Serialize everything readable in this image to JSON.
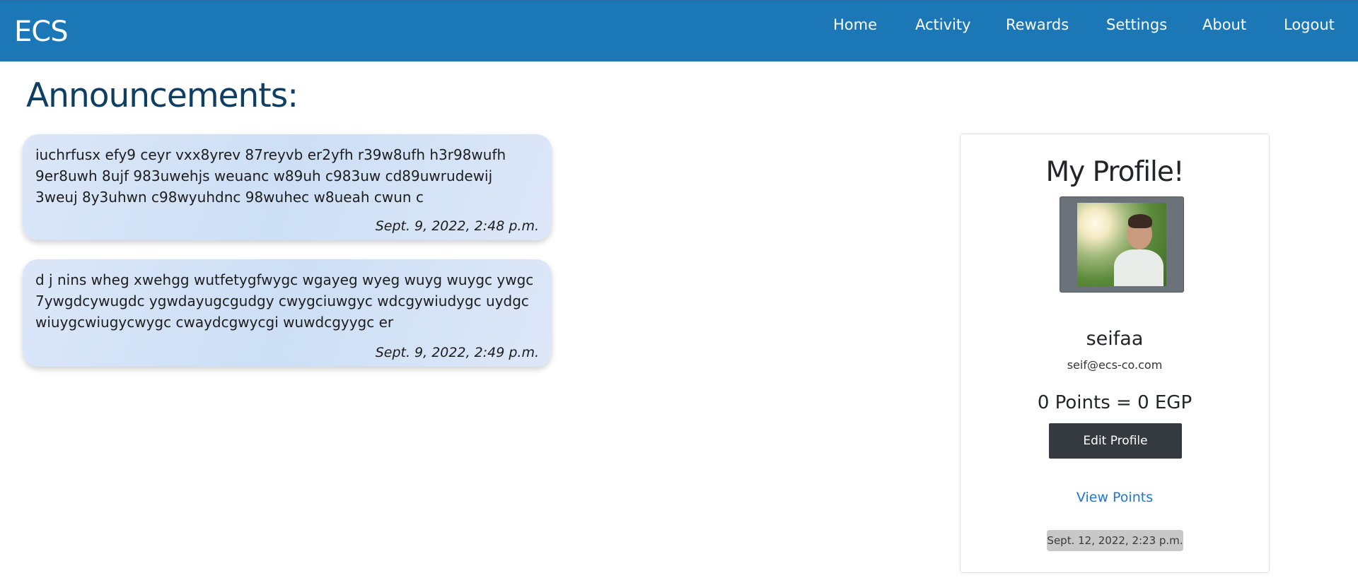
{
  "navbar": {
    "brand": "ECS",
    "links": [
      "Home",
      "Activity",
      "Rewards",
      "Settings",
      "About",
      "Logout"
    ]
  },
  "page": {
    "title": "Announcements:"
  },
  "announcements": [
    {
      "text": "iuchrfusx efy9 ceyr vxx8yrev 87reyvb er2yfh r39w8ufh h3r98wufh 9er8uwh 8ujf 983uwehjs weuanc w89uh c983uw cd89uwrudewij 3weuj 8y3uhwn c98wyuhdnc 98wuhec w8ueah cwun c",
      "time": "Sept. 9, 2022, 2:48 p.m."
    },
    {
      "text": "d j nins wheg xwehgg wutfetygfwygc wgayeg wyeg wuyg wuygc ywgc 7ywgdcywugdc ygwdayugcgudgy cwygciuwgyc wdcgywiudygc uydgc wiuygcwiugycwygc cwaydcgwycgi wuwdcgyygc er",
      "time": "Sept. 9, 2022, 2:49 p.m."
    }
  ],
  "profile": {
    "title": "My Profile!",
    "username": "seifaa",
    "email": "seif@ecs-co.com",
    "points": "0 Points = 0 EGP",
    "edit_label": "Edit Profile",
    "view_points_label": "View Points",
    "date": "Sept. 12, 2022, 2:23 p.m."
  }
}
